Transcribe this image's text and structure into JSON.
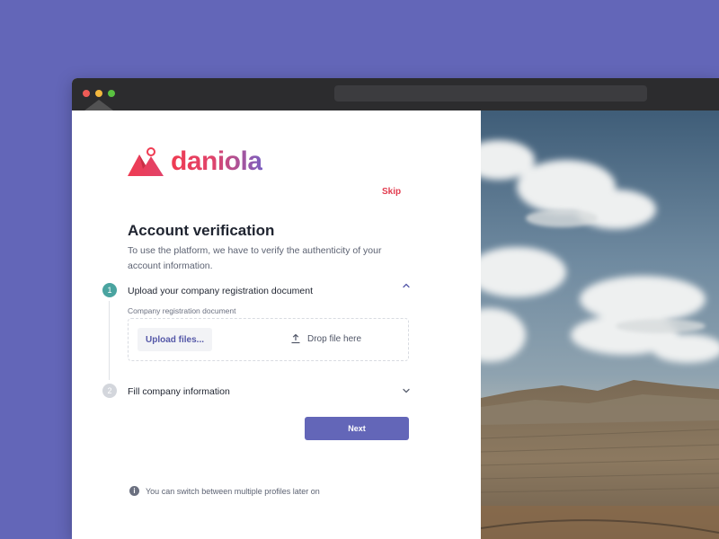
{
  "brand": {
    "name": "daniola",
    "gradient_start": "#ef3b52",
    "gradient_end": "#7b5fc0"
  },
  "header": {
    "skip_label": "Skip"
  },
  "main": {
    "title": "Account verification",
    "subtitle": "To use the platform, we have to verify the authenticity of your account information."
  },
  "steps": [
    {
      "number": "1",
      "title": "Upload your company registration document",
      "state": "active",
      "expanded": true,
      "icon": "chevron-up-icon"
    },
    {
      "number": "2",
      "title": "Fill company information",
      "state": "inactive",
      "expanded": false,
      "icon": "chevron-down-icon"
    }
  ],
  "upload": {
    "field_label": "Company registration document",
    "button_label": "Upload files...",
    "drop_label": "Drop file here",
    "drop_icon": "upload-icon"
  },
  "actions": {
    "next_label": "Next"
  },
  "footer": {
    "info_text": "You can switch between multiple profiles later on",
    "info_icon": "info-icon"
  },
  "colors": {
    "accent": "#6366b8",
    "step_active": "#4aa4a0",
    "step_inactive": "#d3d6dc",
    "skip": "#e23b4e"
  }
}
